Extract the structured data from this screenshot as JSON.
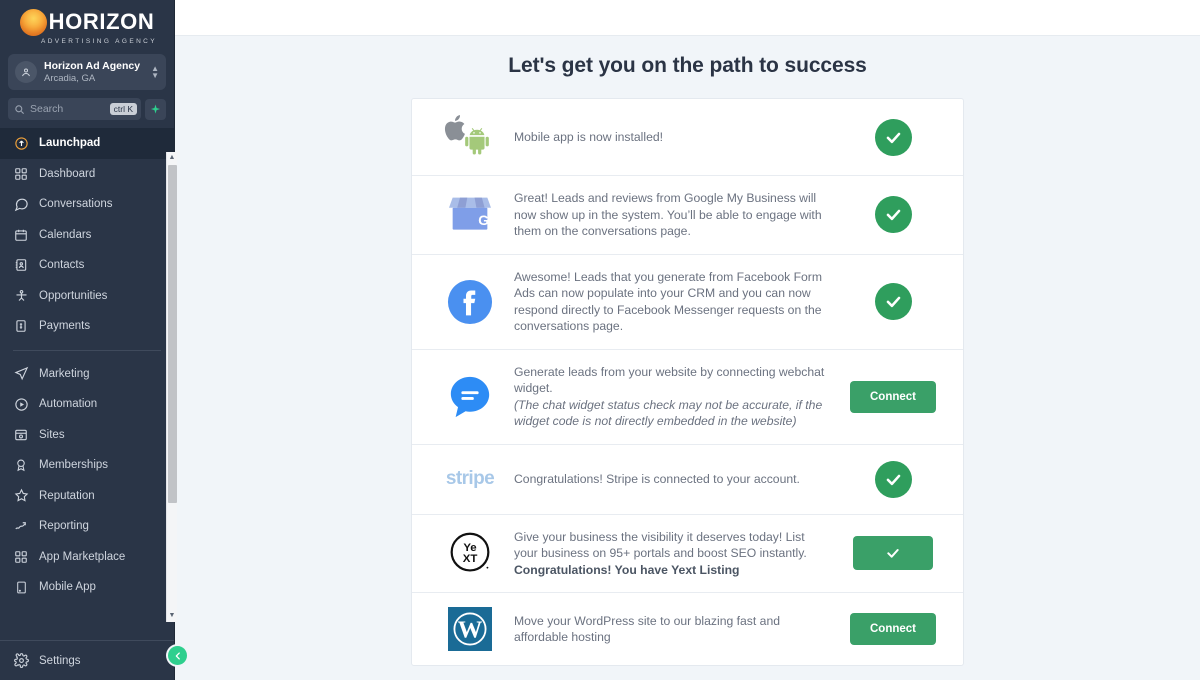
{
  "brand": {
    "logo_word": "HORIZON",
    "logo_sub": "ADVERTISING AGENCY",
    "logo_icon": "sun-icon",
    "accent_green": "#2f9e5d",
    "button_green": "#3aa068",
    "sidebar_bg": "#2a3547",
    "content_bg": "#f1f5f9"
  },
  "sidebar": {
    "agency": {
      "name": "Horizon Ad Agency",
      "location": "Arcadia, GA",
      "avatar_icon": "user-location-icon",
      "caret_icon": "chevron-up-down-icon"
    },
    "search": {
      "placeholder": "Search",
      "shortcut": "ctrl K",
      "icon": "search-icon",
      "spark_icon": "sparkle-icon"
    },
    "items": [
      {
        "label": "Launchpad",
        "icon": "rocket-icon",
        "active": true
      },
      {
        "label": "Dashboard",
        "icon": "grid-icon",
        "active": false
      },
      {
        "label": "Conversations",
        "icon": "chat-bubble-icon",
        "active": false
      },
      {
        "label": "Calendars",
        "icon": "calendar-icon",
        "active": false
      },
      {
        "label": "Contacts",
        "icon": "contacts-icon",
        "active": false
      },
      {
        "label": "Opportunities",
        "icon": "opportunities-icon",
        "active": false
      },
      {
        "label": "Payments",
        "icon": "payments-icon",
        "active": false
      }
    ],
    "items_secondary": [
      {
        "label": "Marketing",
        "icon": "paper-plane-icon",
        "active": false
      },
      {
        "label": "Automation",
        "icon": "play-circle-icon",
        "active": false
      },
      {
        "label": "Sites",
        "icon": "sites-icon",
        "active": false
      },
      {
        "label": "Memberships",
        "icon": "badge-icon",
        "active": false
      },
      {
        "label": "Reputation",
        "icon": "star-icon",
        "active": false
      },
      {
        "label": "Reporting",
        "icon": "trend-up-icon",
        "active": false
      },
      {
        "label": "App Marketplace",
        "icon": "grid-icon",
        "active": false
      },
      {
        "label": "Mobile App",
        "icon": "mobile-icon",
        "active": false
      }
    ],
    "settings": {
      "label": "Settings",
      "icon": "gear-icon"
    },
    "collapse_icon": "chevron-left-icon",
    "scrollbar": {
      "up_icon": "caret-up-icon",
      "down_icon": "caret-down-icon"
    }
  },
  "main": {
    "title": "Let's get you on the path to success",
    "rows": [
      {
        "icon": "apple-android-icon",
        "text": "Mobile app is now installed!",
        "italic": "",
        "bold": "",
        "action": {
          "type": "check-circle",
          "label": "",
          "icon": "check-icon"
        }
      },
      {
        "icon": "google-my-business-icon",
        "text": "Great! Leads and reviews from Google My Business will now show up in the system. You’ll be able to engage with them on the conversations page.",
        "italic": "",
        "bold": "",
        "action": {
          "type": "check-circle",
          "label": "",
          "icon": "check-icon"
        }
      },
      {
        "icon": "facebook-icon",
        "text": "Awesome! Leads that you generate from Facebook Form Ads can now populate into your CRM and you can now respond directly to Facebook Messenger requests on the conversations page.",
        "italic": "",
        "bold": "",
        "action": {
          "type": "check-circle",
          "label": "",
          "icon": "check-icon"
        }
      },
      {
        "icon": "webchat-widget-icon",
        "text": "Generate leads from your website by connecting webchat widget.",
        "italic": "(The chat widget status check may not be accurate, if the widget code is not directly embedded in the website)",
        "bold": "",
        "action": {
          "type": "button",
          "label": "Connect",
          "icon": ""
        }
      },
      {
        "icon": "stripe-icon",
        "text": "Congratulations! Stripe is connected to your account.",
        "italic": "",
        "bold": "",
        "action": {
          "type": "check-circle",
          "label": "",
          "icon": "check-icon"
        }
      },
      {
        "icon": "yext-icon",
        "text": "Give your business the visibility it deserves today! List your business on 95+ portals and boost SEO instantly.",
        "italic": "",
        "bold": "Congratulations! You have Yext Listing",
        "action": {
          "type": "button-check",
          "label": "",
          "icon": "check-icon"
        }
      },
      {
        "icon": "wordpress-icon",
        "text": "Move your WordPress site to our blazing fast and affordable hosting",
        "italic": "",
        "bold": "",
        "action": {
          "type": "button",
          "label": "Connect",
          "icon": ""
        }
      }
    ],
    "stripe_wordmark": "stripe"
  }
}
